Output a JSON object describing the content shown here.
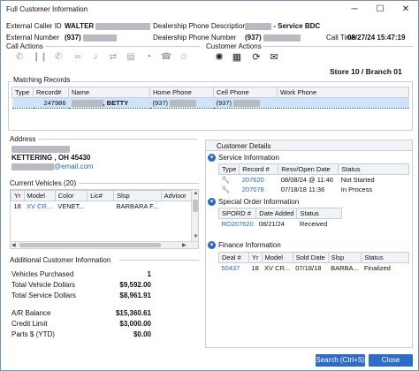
{
  "window": {
    "title": "Full Customer Information",
    "controls": {
      "minimize": "─",
      "maximize": "☐",
      "close": "✕"
    }
  },
  "caller": {
    "external_caller_id_label": "External Caller ID",
    "external_caller_id_value": "WALTER",
    "external_number_label": "External Number",
    "external_number_value": "(937)",
    "dealership_phone_desc_label": "Dealership Phone Description",
    "dealership_phone_desc_value": "- Service BDC",
    "dealership_phone_number_label": "Dealership Phone Number",
    "dealership_phone_number_value": "(937)",
    "call_time_label": "Call Time",
    "call_time_value": "08/27/24 15:47:19"
  },
  "call_actions": {
    "label": "Call Actions",
    "icons": [
      "phone-icon",
      "pause-icon",
      "call-forward-icon",
      "voicemail-icon",
      "microphone-icon",
      "transfer-icon",
      "note-icon",
      "park-icon",
      "hangup-icon",
      "person-icon"
    ]
  },
  "customer_actions": {
    "label": "Customer Actions",
    "icons": [
      "sun-icon",
      "calendar-icon",
      "refresh-icon",
      "envelope-icon"
    ]
  },
  "store_label": "Store 10 / Branch 01",
  "matching_records": {
    "title": "Matching Records",
    "columns": [
      "Type",
      "Record#",
      "Name",
      "Home Phone",
      "Cell Phone",
      "Work Phone"
    ],
    "rows": [
      {
        "type": "",
        "record": "247986",
        "name": ", BETTY",
        "home_phone": "(937)",
        "cell_phone": "(937)",
        "work_phone": ""
      }
    ]
  },
  "address": {
    "title": "Address",
    "city_line": "KETTERING , OH 45430",
    "email": "@email.com"
  },
  "vehicles": {
    "title": "Current Vehicles (20)",
    "columns": [
      "Yr",
      "Model",
      "Color",
      "Lic#",
      "Slsp",
      "Advisor"
    ],
    "rows": [
      {
        "yr": "18",
        "model": "XV CR...",
        "color": "VENET...",
        "lic": "",
        "slsp": "BARBARA F...",
        "advisor": ""
      }
    ]
  },
  "additional_info": {
    "title": "Additional Customer Information",
    "items": [
      {
        "label": "Vehicles Purchased",
        "value": "1"
      },
      {
        "label": "Total Vehicle Dollars",
        "value": "$9,592.00"
      },
      {
        "label": "Total Service Dollars",
        "value": "$8,961.91"
      },
      {
        "label": "A/R Balance",
        "value": "$15,360.61"
      },
      {
        "label": "Credit Limit",
        "value": "$3,000.00"
      },
      {
        "label": "Parts $ (YTD)",
        "value": "$0.00"
      }
    ]
  },
  "customer_details": {
    "title": "Customer Details",
    "service": {
      "title": "Service Information",
      "columns": [
        "Type",
        "Record #",
        "Resv/Open Date",
        "Status"
      ],
      "rows": [
        {
          "record": "207620",
          "date": "08/08/24 @ 11:46",
          "status": "Not Started"
        },
        {
          "record": "207078",
          "date": "07/18/18 11:36",
          "status": "In Process"
        }
      ]
    },
    "special_order": {
      "title": "Special Order Information",
      "columns": [
        "SPORD #",
        "Date Added",
        "Status"
      ],
      "rows": [
        {
          "spord": "RO207620",
          "date": "08/21/24",
          "status": "Received"
        }
      ]
    },
    "finance": {
      "title": "Finance Information",
      "columns": [
        "Deal #",
        "Yr",
        "Model",
        "Sold Date",
        "Slsp",
        "Status"
      ],
      "rows": [
        {
          "deal": "50437",
          "yr": "18",
          "model": "XV CR...",
          "sold": "07/18/18",
          "slsp": "BARBA...",
          "status": "Finalized"
        }
      ]
    }
  },
  "buttons": {
    "search": "Search (Ctrl+S)",
    "close": "Close"
  },
  "colors": {
    "accent": "#2f6cc8",
    "link": "#1c64c8",
    "selection": "#cfe3fb"
  }
}
